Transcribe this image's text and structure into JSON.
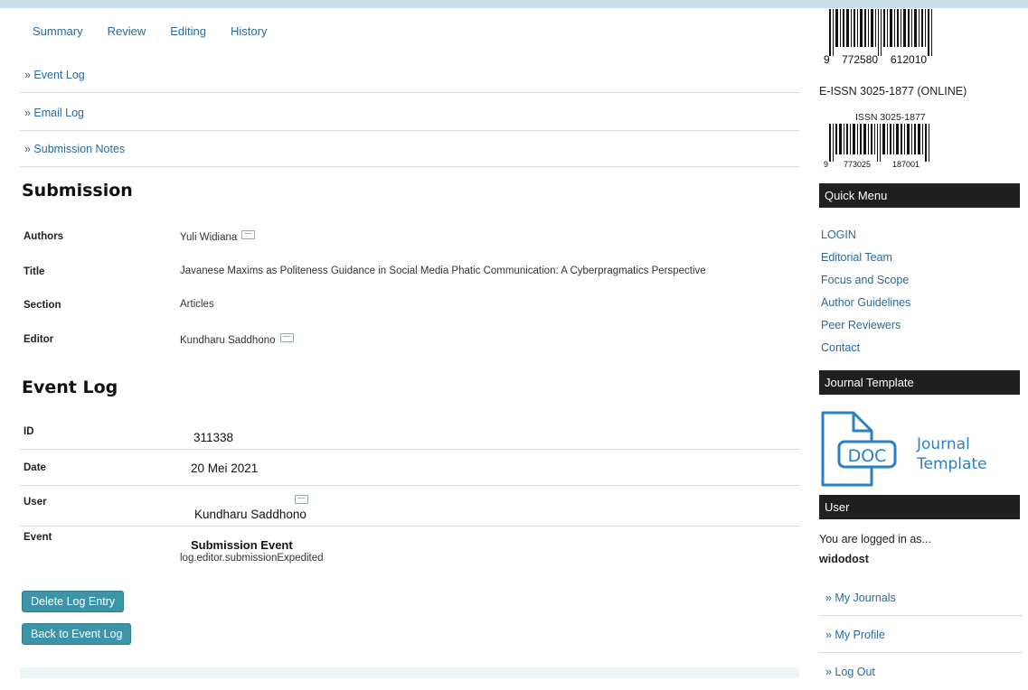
{
  "tabs": [
    "Summary",
    "Review",
    "Editing",
    "History"
  ],
  "sublinks": [
    "» Event Log",
    "» Email Log",
    "» Submission Notes"
  ],
  "submission": {
    "heading": "Submission",
    "authors_label": "Authors",
    "authors_value": "Yuli Widiana",
    "title_label": "Title",
    "title_value": "Javanese Maxims as Politeness Guidance in Social Media Phatic Communication: A Cyberpragmatics Perspective",
    "section_label": "Section",
    "section_value": "Articles",
    "editor_label": "Editor",
    "editor_value": "Kundharu Saddhono"
  },
  "event_log": {
    "heading": "Event Log",
    "id_label": "ID",
    "id_value": "311338",
    "date_label": "Date",
    "date_value": "20 Mei 2021",
    "user_label": "User",
    "user_value": "Kundharu Saddhono",
    "event_label": "Event",
    "event_title": "Submission Event",
    "event_key": "log.editor.submissionExpedited"
  },
  "buttons": {
    "delete": "Delete Log Entry",
    "back": "Back to Event Log"
  },
  "sidebar": {
    "barcode1_digits": [
      "9",
      "772580",
      "612010"
    ],
    "eissn": "E-ISSN 3025-1877 (ONLINE)",
    "issn": "ISSN 3025-1877",
    "barcode2_digits": [
      "9",
      "773025",
      "187001"
    ],
    "quick_menu_title": "Quick Menu",
    "quick_menu": [
      "LOGIN",
      "Editorial Team",
      "Focus and Scope",
      "Author Guidelines",
      "Peer Reviewers",
      "Contact"
    ],
    "journal_template_title": "Journal Template",
    "doc_label": "DOC",
    "doc_caption_1": "Journal",
    "doc_caption_2": "Template",
    "user_title": "User",
    "logged_in_text": "You are logged in as...",
    "username": "widodost",
    "user_links": [
      "» My Journals",
      "» My Profile",
      "» Log Out"
    ]
  },
  "colors": {
    "link": "#2b6a9c",
    "button": "#3d94a8",
    "sidebar_header": "#1f1f1f",
    "doc_blue": "#2b7fc4"
  }
}
